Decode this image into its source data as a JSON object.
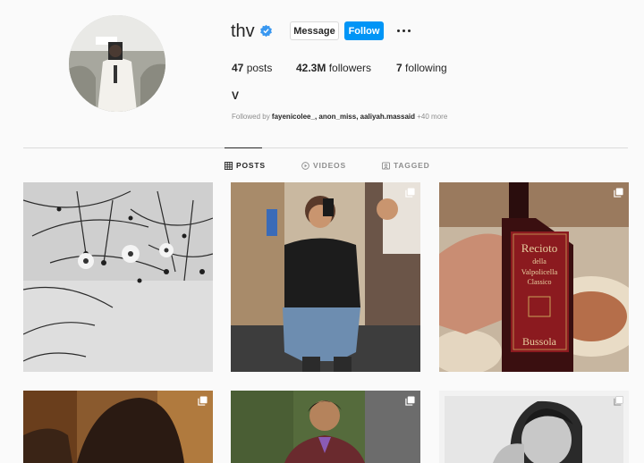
{
  "profile": {
    "username": "thv",
    "fullname": "V",
    "message_label": "Message",
    "follow_label": "Follow",
    "posts_count": "47",
    "posts_label": "posts",
    "followers_count": "42.3M",
    "followers_label": "followers",
    "following_count": "7",
    "following_label": "following",
    "followed_by_prefix": "Followed by",
    "followed_by_users": "fayenicolee_, anon_miss, aaliyah.massaid",
    "followed_by_more": "+40 more"
  },
  "tabs": [
    {
      "label": "POSTS",
      "icon": "grid-icon",
      "active": true
    },
    {
      "label": "VIDEOS",
      "icon": "video-icon",
      "active": false
    },
    {
      "label": "TAGGED",
      "icon": "tag-icon",
      "active": false
    }
  ],
  "posts": [
    {
      "alt": "black and white flowers",
      "multi": false
    },
    {
      "alt": "mirror selfie in sleeveless shirt",
      "multi": true
    },
    {
      "alt": "hand holding wine bottle",
      "multi": true
    },
    {
      "alt": "warm toned portrait",
      "multi": true
    },
    {
      "alt": "portrait in burgundy suit",
      "multi": true
    },
    {
      "alt": "black and white portrait",
      "multi": true
    }
  ],
  "wine_label": {
    "line1": "Recioto",
    "line2": "della",
    "line3": "Valpolicella",
    "line4": "Classico",
    "brand": "Bussola"
  },
  "colors": {
    "follow": "#0095f6",
    "verified": "#3897f0",
    "text": "#262626",
    "muted": "#8e8e8e"
  }
}
